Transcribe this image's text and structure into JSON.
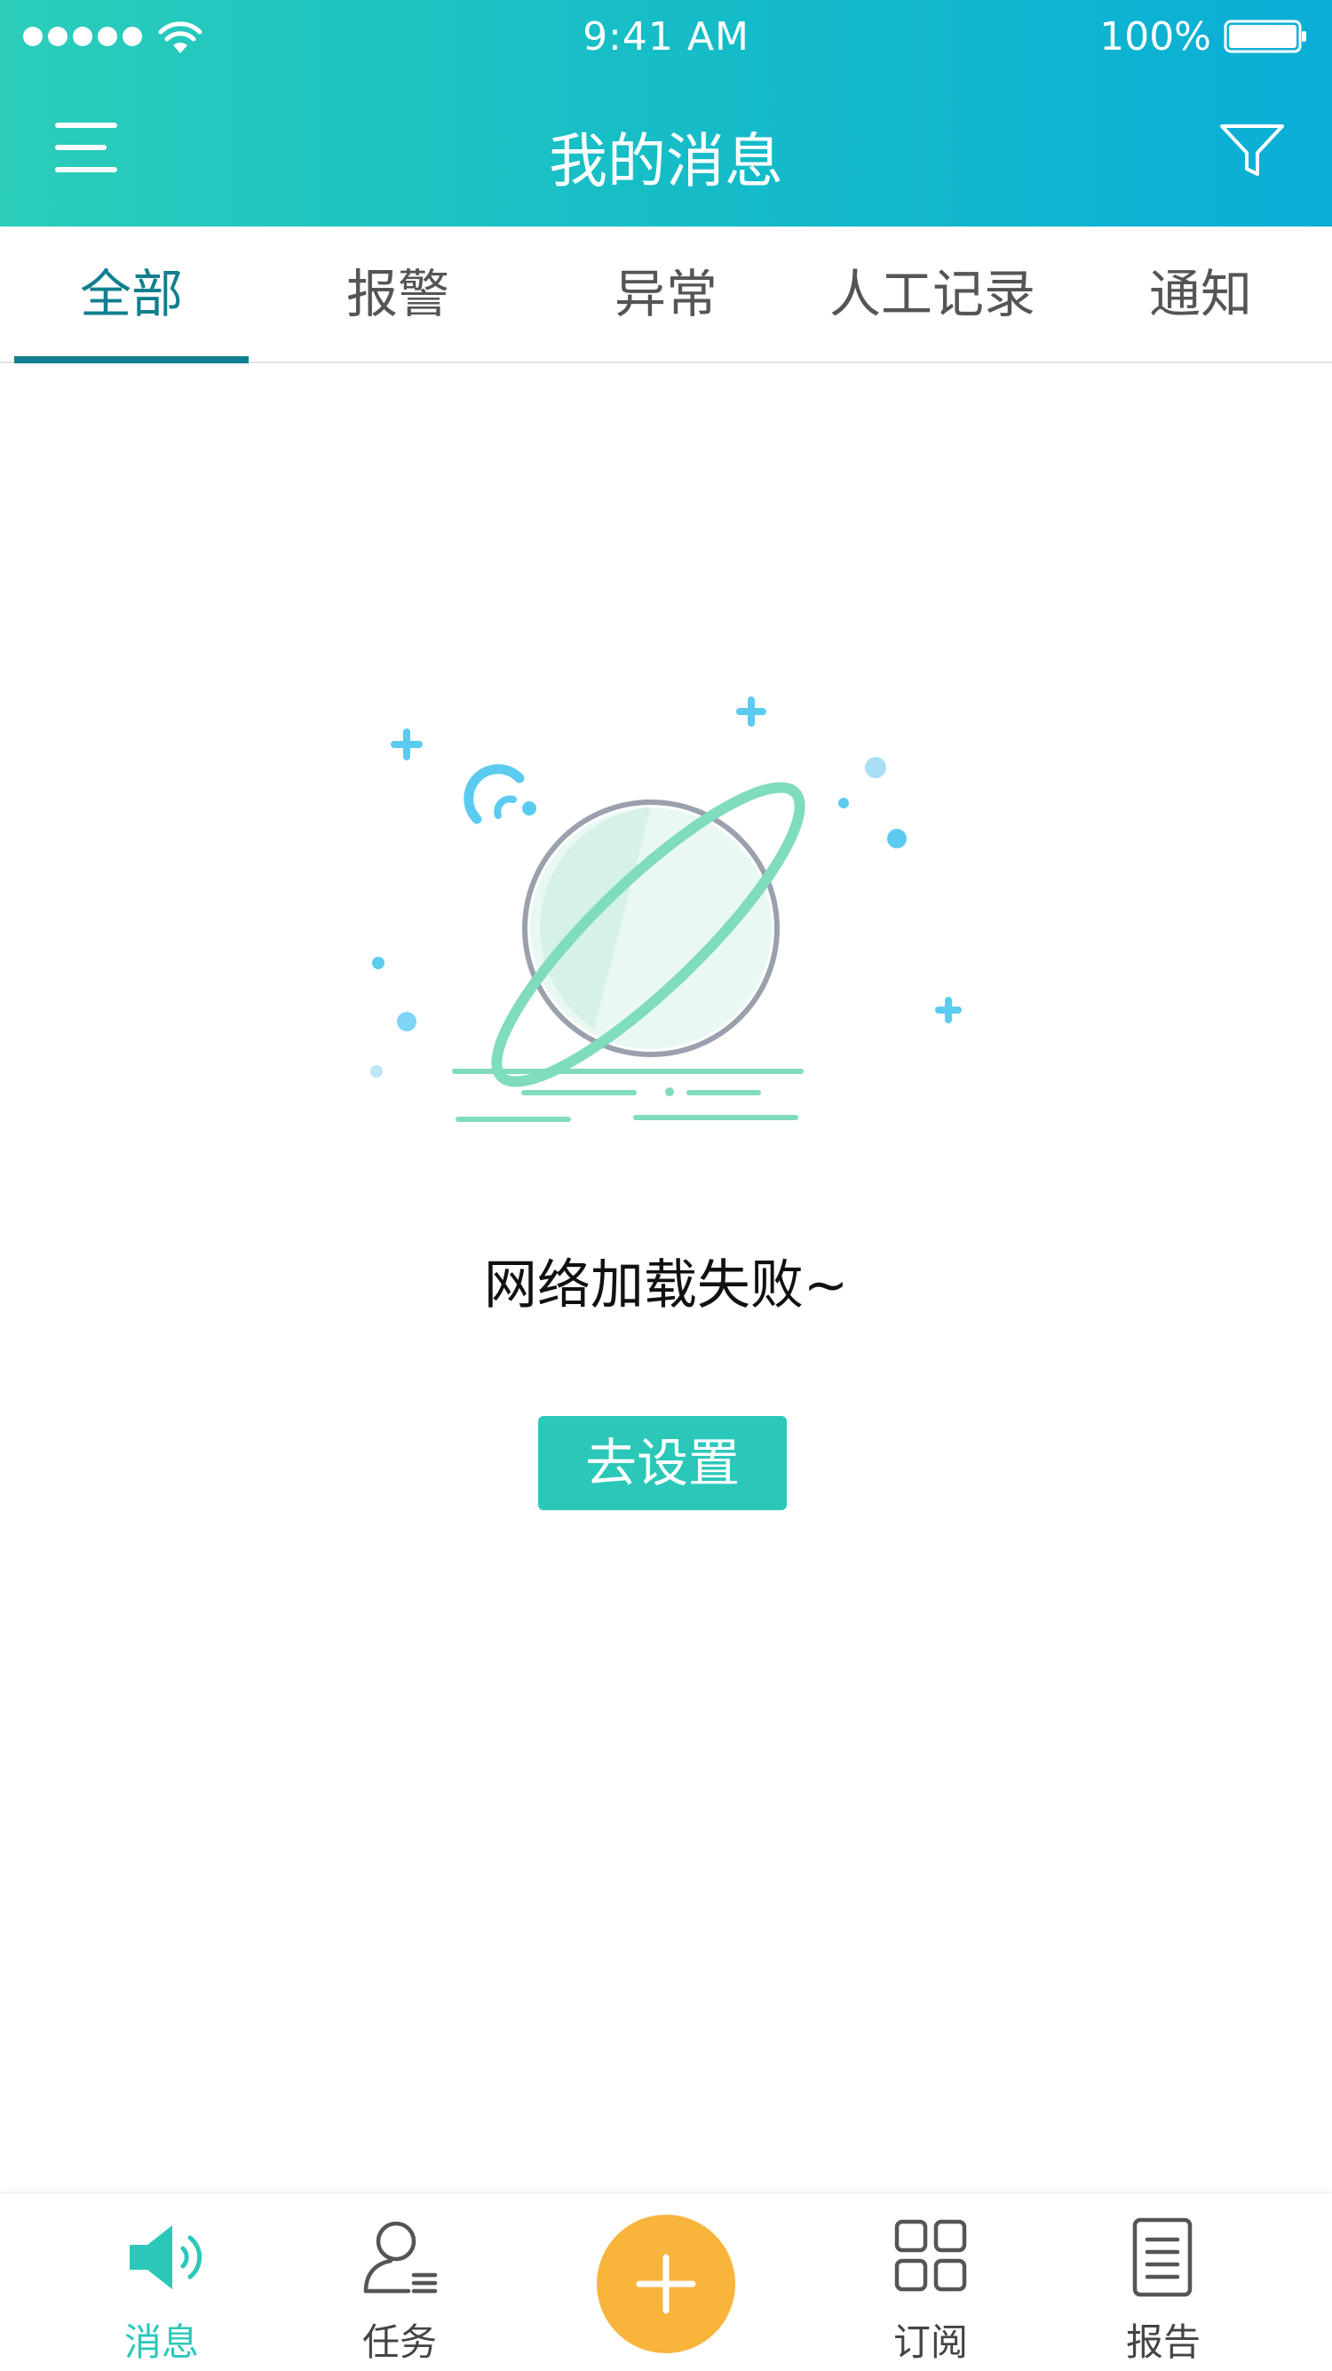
{
  "status_bar": {
    "time": "9:41 AM",
    "battery": "100%",
    "icons": [
      "signal-dots-icon",
      "wifi-icon",
      "battery-icon"
    ]
  },
  "nav": {
    "title": "我的消息",
    "left_icon": "menu-icon",
    "right_icon": "filter-icon"
  },
  "tabs": [
    {
      "label": "全部",
      "active": true
    },
    {
      "label": "报警",
      "active": false
    },
    {
      "label": "异常",
      "active": false
    },
    {
      "label": "人工记录",
      "active": false
    },
    {
      "label": "通知",
      "active": false
    }
  ],
  "empty_state": {
    "illustration": "planet-illustration",
    "message": "网络加载失败~",
    "button_label": "去设置"
  },
  "tabbar": {
    "items": [
      {
        "label": "消息",
        "icon": "speaker-icon",
        "active": true
      },
      {
        "label": "任务",
        "icon": "person-list-icon",
        "active": false
      },
      {
        "label": "订阅",
        "icon": "grid-icon",
        "active": false
      },
      {
        "label": "报告",
        "icon": "document-icon",
        "active": false
      }
    ],
    "center_button_icon": "plus-icon"
  },
  "colors": {
    "header_gradient_start": "#2bcdb9",
    "header_gradient_end": "#0aaed6",
    "tab_active": "#117f8f",
    "accent": "#2bc8b9",
    "fab": "#f9b43c"
  }
}
